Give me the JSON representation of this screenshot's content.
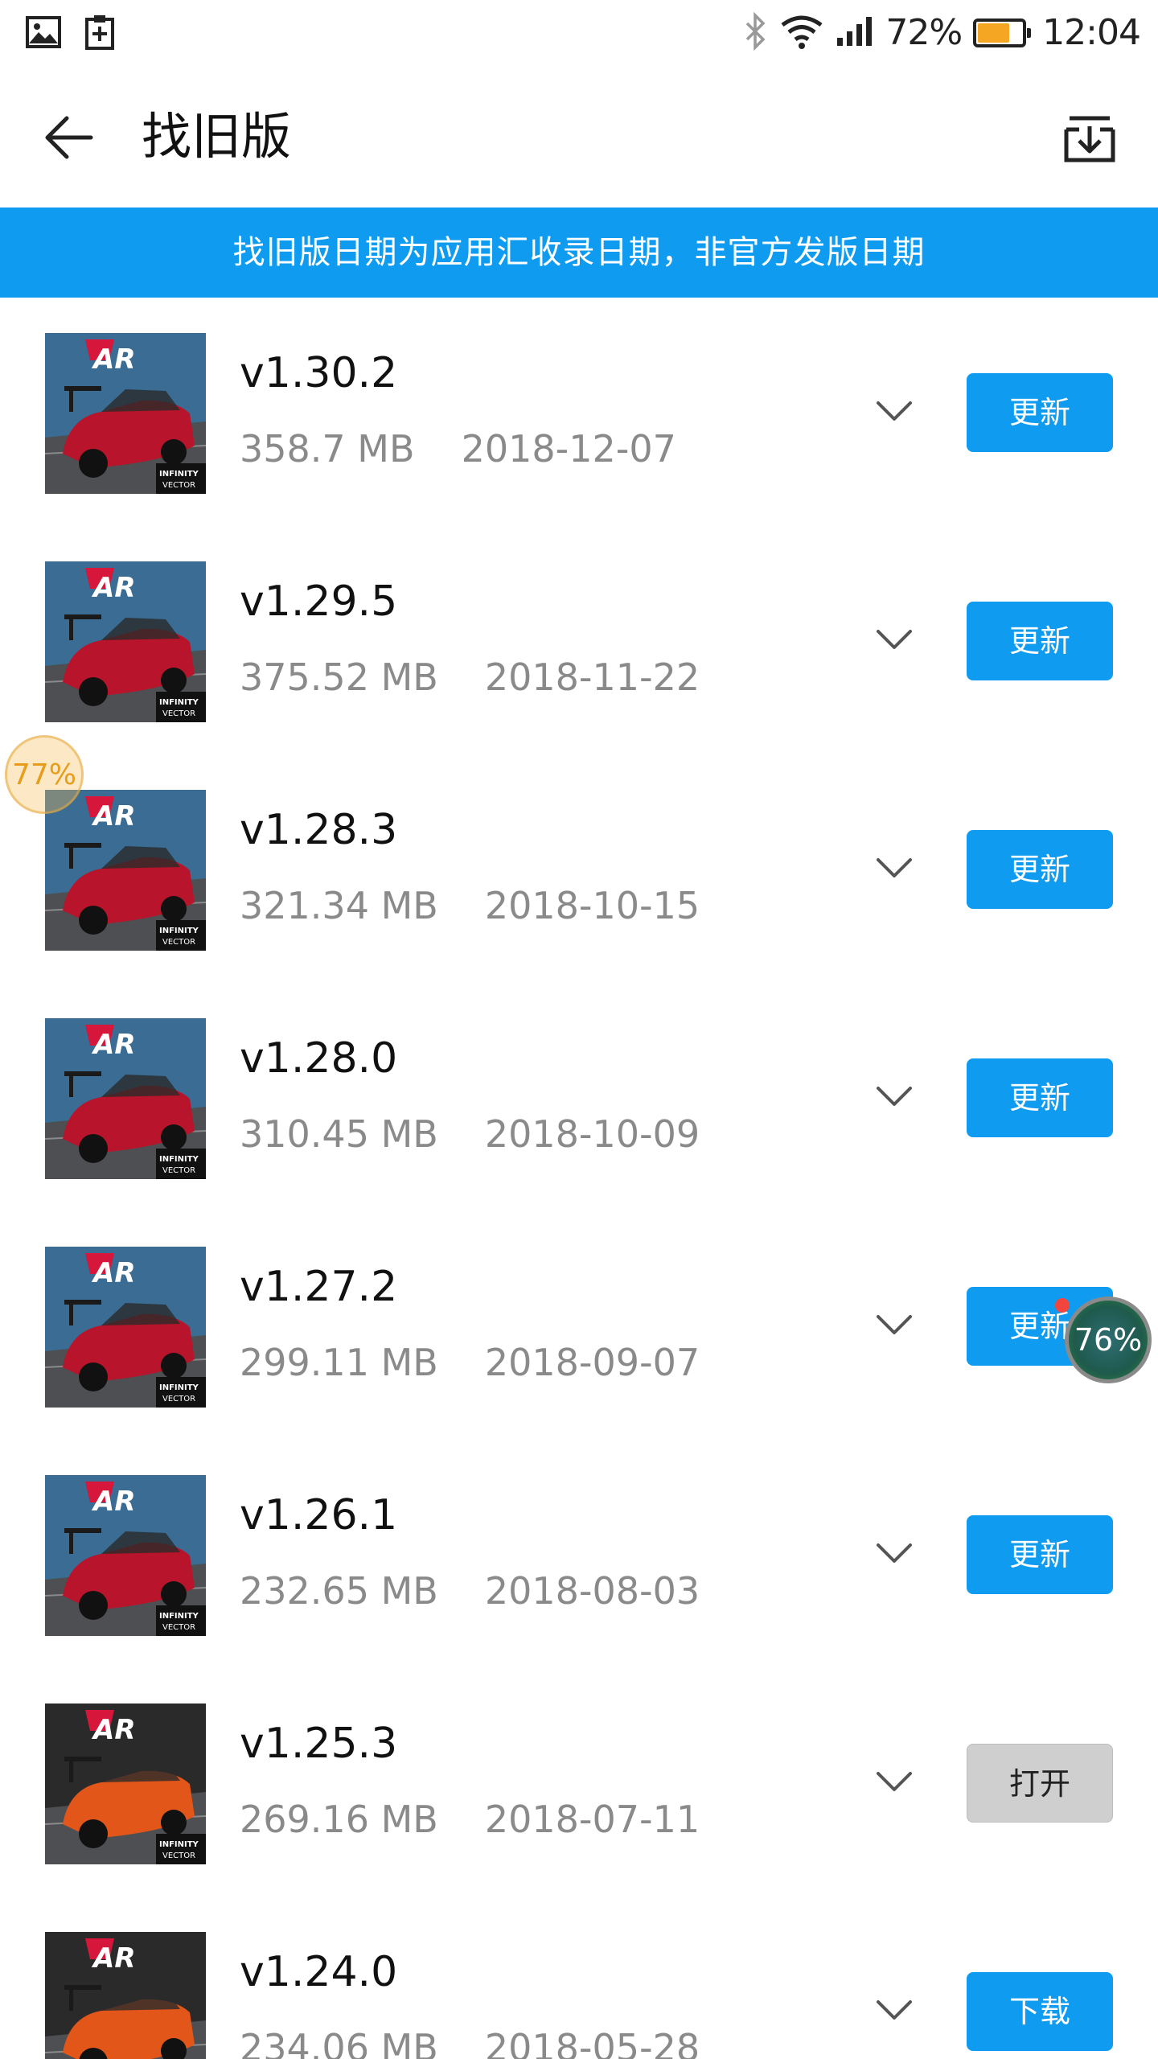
{
  "status_bar": {
    "battery_percent": "72%",
    "battery_level": 0.72,
    "time": "12:04",
    "icons": [
      "image-icon",
      "clipboard-plus-icon",
      "bluetooth-icon",
      "wifi-icon",
      "signal-icon",
      "battery-icon"
    ]
  },
  "app_bar": {
    "title": "找旧版"
  },
  "notice": "找旧版日期为应用汇收录日期，非官方发版日期",
  "versions": [
    {
      "version": "v1.30.2",
      "size": "358.7 MB",
      "date": "2018-12-07",
      "action": "更新",
      "style": "primary",
      "thumb_variant": "red"
    },
    {
      "version": "v1.29.5",
      "size": "375.52 MB",
      "date": "2018-11-22",
      "action": "更新",
      "style": "primary",
      "thumb_variant": "red"
    },
    {
      "version": "v1.28.3",
      "size": "321.34 MB",
      "date": "2018-10-15",
      "action": "更新",
      "style": "primary",
      "thumb_variant": "red"
    },
    {
      "version": "v1.28.0",
      "size": "310.45 MB",
      "date": "2018-10-09",
      "action": "更新",
      "style": "primary",
      "thumb_variant": "red"
    },
    {
      "version": "v1.27.2",
      "size": "299.11 MB",
      "date": "2018-09-07",
      "action": "更新",
      "style": "primary",
      "thumb_variant": "red"
    },
    {
      "version": "v1.26.1",
      "size": "232.65 MB",
      "date": "2018-08-03",
      "action": "更新",
      "style": "primary",
      "thumb_variant": "red"
    },
    {
      "version": "v1.25.3",
      "size": "269.16 MB",
      "date": "2018-07-11",
      "action": "打开",
      "style": "secondary",
      "thumb_variant": "orange"
    },
    {
      "version": "v1.24.0",
      "size": "234.06 MB",
      "date": "2018-05-28",
      "action": "下载",
      "style": "primary",
      "thumb_variant": "orange"
    }
  ],
  "thumb_text": {
    "logo": "AR",
    "badge_line1": "INFINITY",
    "badge_line2": "VECTOR"
  },
  "floating_left": "77%",
  "floating_right": "76%",
  "colors": {
    "accent": "#0e9bf0",
    "secondary_button": "#cfcfcf",
    "meta_text": "#8a8a8a"
  }
}
